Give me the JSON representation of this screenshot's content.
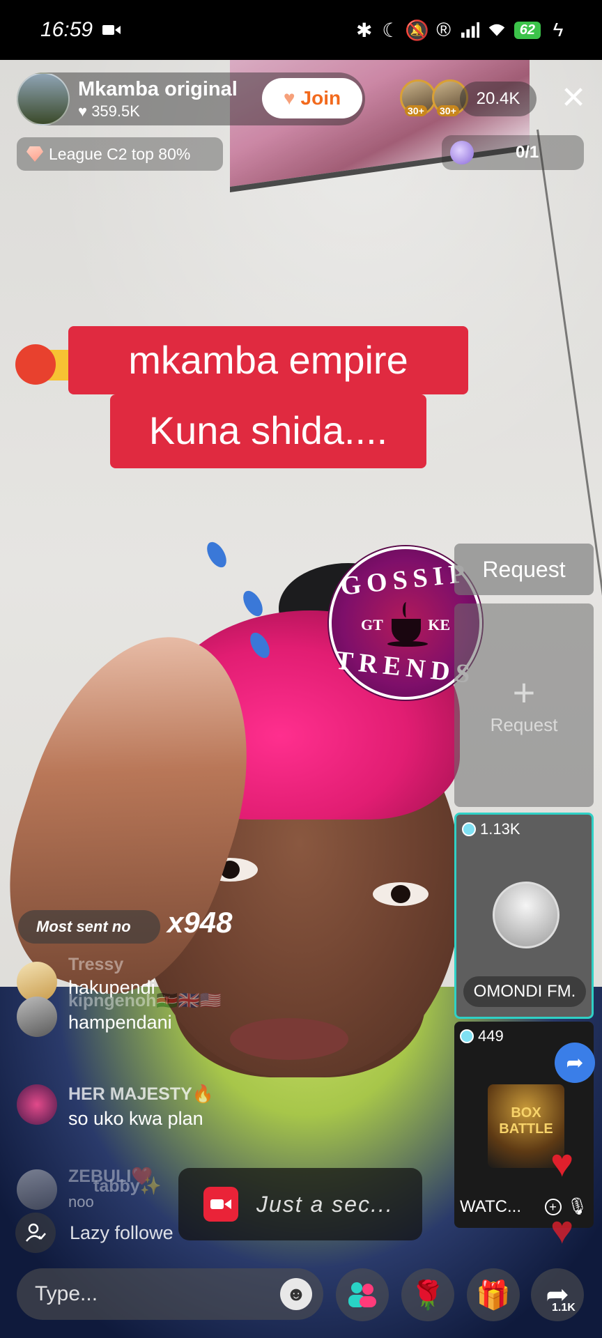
{
  "status_bar": {
    "time": "16:59",
    "battery": "62"
  },
  "host": {
    "name": "Mkamba original",
    "likes": "359.5K",
    "join_label": "Join"
  },
  "viewers": {
    "badge_levels": [
      "30+",
      "30+"
    ],
    "count": "20.4K"
  },
  "league": {
    "label": "League C2 top 80%"
  },
  "score": {
    "value": "0/1"
  },
  "caption": {
    "line1": "mkamba empire",
    "line2": "Kuna shida...."
  },
  "watermark": {
    "top": "GOSSIP",
    "bottom": "TRENDS",
    "left": "GT",
    "right": "KE"
  },
  "request_panel": {
    "header": "Request",
    "slot_plus": "+",
    "slot_label": "Request"
  },
  "guests": [
    {
      "count": "1.13K",
      "name": "OMONDI FM."
    },
    {
      "count": "449",
      "name": "WATC...",
      "poster_text": "BOX BATTLE"
    }
  ],
  "gift_streak": {
    "label": "Most sent no",
    "count": "x948"
  },
  "chat": [
    {
      "user": "Tressy",
      "text": "hakupendi"
    },
    {
      "user": "kipngenoh🇰🇪🇬🇧🇺🇸",
      "text": "hampendani"
    },
    {
      "user": "HER MAJESTY🔥",
      "text": "so uko kwa plan"
    },
    {
      "user": "ZEBULI❤️",
      "text": "noo"
    },
    {
      "user": "tabby✨",
      "text": ""
    }
  ],
  "toast": {
    "text": "Just a sec..."
  },
  "follow_hint": {
    "text": "Lazy followe"
  },
  "bottom_bar": {
    "input_placeholder": "Type...",
    "share_count": "1.1K"
  },
  "colors": {
    "caption_bg": "#e02a40",
    "join_text": "#f26a1d",
    "guest_border": "#2fd1c6",
    "heart": "#e0202c"
  }
}
